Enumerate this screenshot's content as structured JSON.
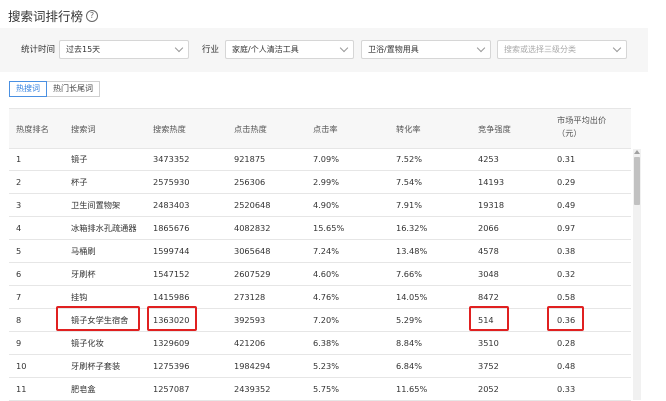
{
  "title": "搜索词排行榜",
  "help_icon": "?",
  "filters": {
    "period_label": "统计时间",
    "period_value": "过去15天",
    "industry_label": "行业",
    "industry_l1": "家庭/个人清洁工具",
    "industry_l2": "卫浴/置物用具",
    "industry_l3_placeholder": "搜索或选择三级分类"
  },
  "tabs": [
    {
      "label": "热搜词",
      "active": true
    },
    {
      "label": "热门长尾词",
      "active": false
    }
  ],
  "columns": [
    "热度排名",
    "搜索词",
    "搜索热度",
    "点击热度",
    "点击率",
    "转化率",
    "竞争强度",
    [
      "市场平均出价",
      "（元）"
    ]
  ],
  "rows": [
    [
      "1",
      "镜子",
      "3473352",
      "921875",
      "7.09%",
      "7.52%",
      "4253",
      "0.31"
    ],
    [
      "2",
      "杯子",
      "2575930",
      "256306",
      "2.99%",
      "7.54%",
      "14193",
      "0.29"
    ],
    [
      "3",
      "卫生间置物架",
      "2483403",
      "2520648",
      "4.90%",
      "7.91%",
      "19318",
      "0.49"
    ],
    [
      "4",
      "冰箱排水孔疏通器",
      "1865676",
      "4082832",
      "15.65%",
      "16.32%",
      "2066",
      "0.97"
    ],
    [
      "5",
      "马桶刷",
      "1599744",
      "3065648",
      "7.24%",
      "13.48%",
      "4578",
      "0.38"
    ],
    [
      "6",
      "牙刷杯",
      "1547152",
      "2607529",
      "4.60%",
      "7.66%",
      "3048",
      "0.32"
    ],
    [
      "7",
      "挂钩",
      "1415986",
      "273128",
      "4.76%",
      "14.05%",
      "8472",
      "0.58"
    ],
    [
      "8",
      "镜子女学生宿舍",
      "1363020",
      "392593",
      "7.20%",
      "5.29%",
      "514",
      "0.36"
    ],
    [
      "9",
      "镜子化妆",
      "1329609",
      "421206",
      "6.38%",
      "8.84%",
      "3510",
      "0.28"
    ],
    [
      "10",
      "牙刷杯子套装",
      "1275396",
      "1984294",
      "5.23%",
      "6.84%",
      "3752",
      "0.48"
    ],
    [
      "11",
      "肥皂盒",
      "1257087",
      "2439352",
      "5.75%",
      "11.65%",
      "2052",
      "0.33"
    ]
  ],
  "highlight_row_index": 7,
  "colors": {
    "accent": "#2f7fe0",
    "highlight": "#e02020",
    "header_bg": "#f7f7f7",
    "filter_bg": "#f6f6f6"
  }
}
